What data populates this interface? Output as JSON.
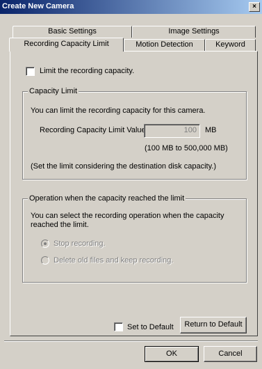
{
  "window": {
    "title": "Create New Camera",
    "close_glyph": "×"
  },
  "tabs": {
    "row1": [
      "Basic Settings",
      "Image Settings"
    ],
    "row2": [
      "Recording Capacity Limit",
      "Motion Detection",
      "Keyword"
    ],
    "active": "Recording Capacity Limit"
  },
  "limit_checkbox": {
    "label": "Limit the recording capacity.",
    "checked": false
  },
  "capacity_group": {
    "title": "Capacity Limit",
    "description": "You can limit the recording capacity for this camera.",
    "value_label": "Recording Capacity Limit Value",
    "value": "100",
    "unit": "MB",
    "range": "(100 MB to 500,000 MB)",
    "note": "(Set the limit considering the destination disk capacity.)"
  },
  "operation_group": {
    "title": "Operation when the capacity reached the limit",
    "description_line1": "You can select the recording operation when the capacity",
    "description_line2": "reached the limit.",
    "options": [
      {
        "label": "Stop recording.",
        "selected": true,
        "enabled": false
      },
      {
        "label": "Delete old files and keep recording.",
        "selected": false,
        "enabled": false
      }
    ]
  },
  "default_checkbox": {
    "label": "Set to Default",
    "checked": false
  },
  "buttons": {
    "return_default": "Return to Default",
    "ok": "OK",
    "cancel": "Cancel"
  }
}
